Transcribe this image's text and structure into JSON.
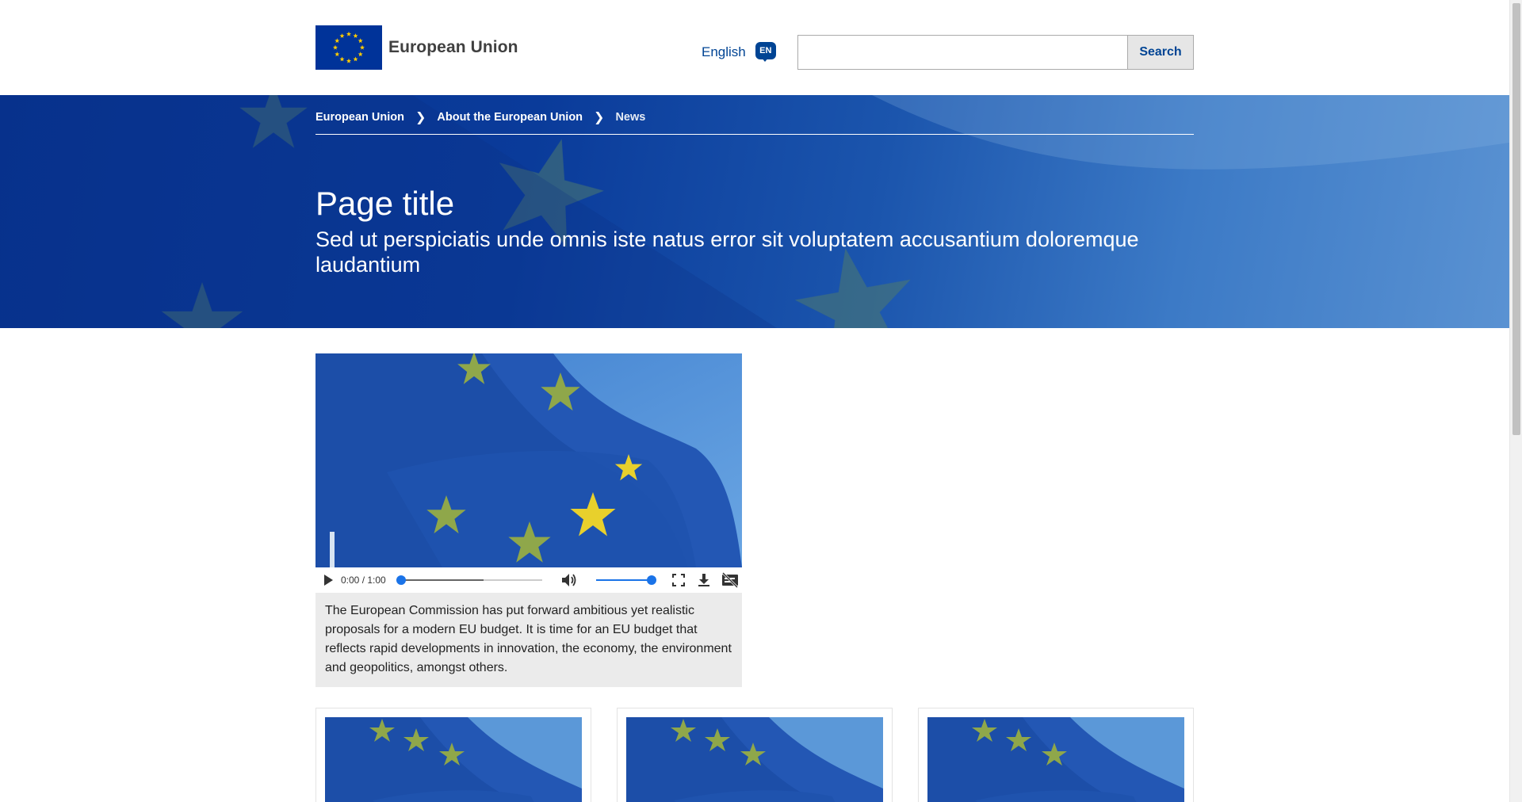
{
  "header": {
    "logo_text": "European Union",
    "language_label": "English",
    "language_code": "EN",
    "search_placeholder": "",
    "search_button": "Search"
  },
  "breadcrumb": {
    "items": [
      {
        "label": "European Union"
      },
      {
        "label": "About the European Union"
      },
      {
        "label": "News"
      }
    ]
  },
  "banner": {
    "title": "Page title",
    "subtitle": "Sed ut perspiciatis unde omnis iste natus error sit voluptatem accusantium doloremque laudantium"
  },
  "media": {
    "time_display": "0:00 / 1:00",
    "caption": "The European Commission has put forward ambitious yet realistic proposals for a modern EU budget. It is time for an EU budget that reflects rapid developments in innovation, the economy, the environment and geopolitics, amongst others.",
    "volume_level": 1.0,
    "progress": 0.0
  },
  "cards": [
    {
      "image": "eu-flag-image"
    },
    {
      "image": "eu-flag-image"
    },
    {
      "image": "eu-flag-image"
    }
  ],
  "colors": {
    "brand_blue": "#004494",
    "flag_blue": "#003399",
    "star_yellow": "#ffcc00"
  }
}
